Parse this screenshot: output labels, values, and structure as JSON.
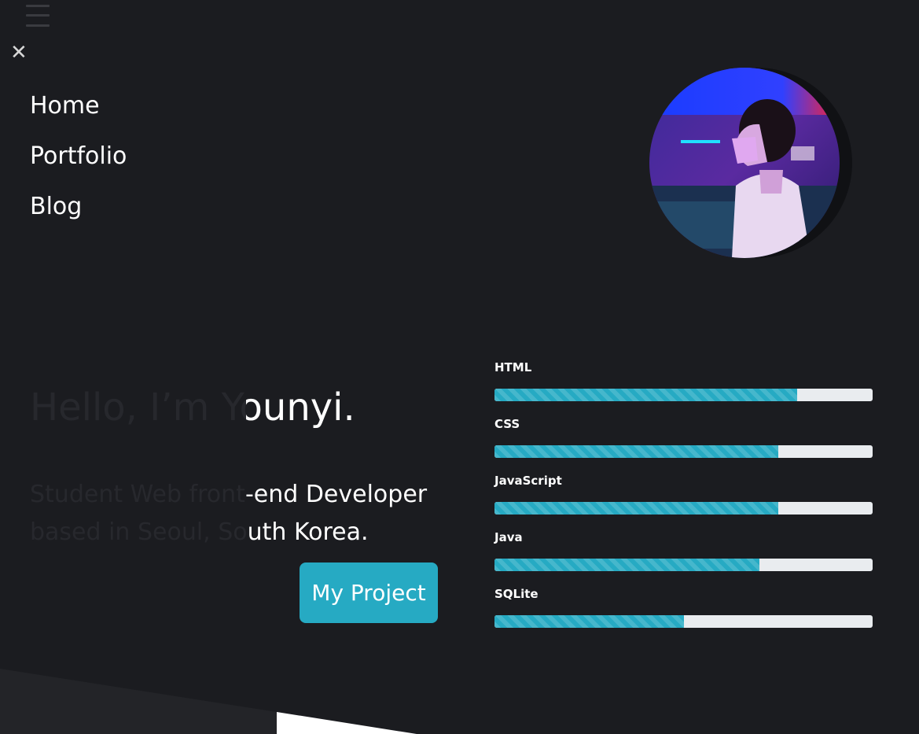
{
  "nav": {
    "items": [
      {
        "label": "Home"
      },
      {
        "label": "Portfolio"
      },
      {
        "label": "Blog"
      }
    ]
  },
  "hero": {
    "title": "Hello, I’m Younyi.",
    "subtitle_line1": "Student Web front-end Developer",
    "subtitle_line2": "based in Seoul, South Korea.",
    "cta_label": "My Project"
  },
  "skills": [
    {
      "name": "HTML",
      "percent": 80
    },
    {
      "name": "CSS",
      "percent": 75
    },
    {
      "name": "JavaScript",
      "percent": 75
    },
    {
      "name": "Java",
      "percent": 70
    },
    {
      "name": "SQLite",
      "percent": 50
    }
  ],
  "colors": {
    "background": "#1b1c20",
    "accent": "#26aac3",
    "bar_track": "#e9ecef"
  },
  "icons": {
    "menu": "hamburger-icon",
    "close": "close-icon"
  }
}
